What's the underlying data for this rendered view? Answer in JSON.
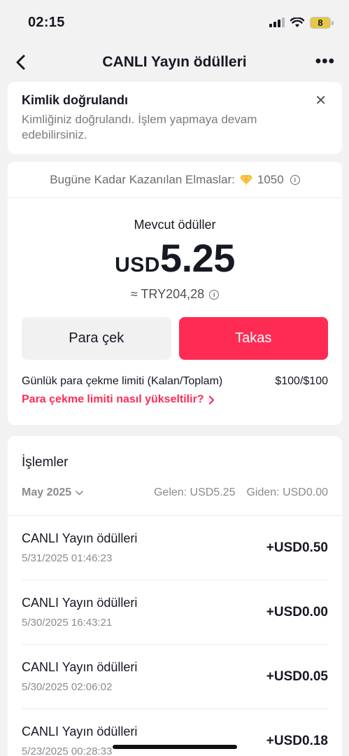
{
  "status": {
    "time": "02:15",
    "battery": "8"
  },
  "nav": {
    "title": "CANLI Yayın ödülleri"
  },
  "verify": {
    "title": "Kimlik doğrulandı",
    "text": "Kimliğiniz doğrulandı. İşlem yapmaya devam edebilirsiniz."
  },
  "balance": {
    "diamonds_label": "Bugüne Kadar Kazanılan Elmaslar:",
    "diamonds_value": "1050",
    "rewards_label": "Mevcut ödüller",
    "currency": "USD",
    "amount": "5.25",
    "try_value": "≈ TRY204,28",
    "withdraw_label": "Para çek",
    "exchange_label": "Takas",
    "limit_label": "Günlük para çekme limiti (Kalan/Toplam)",
    "limit_value": "$100/$100",
    "limit_link": "Para çekme limiti nasıl yükseltilir?"
  },
  "transactions": {
    "title": "İşlemler",
    "month": "May 2025",
    "incoming": "Gelen: USD5.25",
    "outgoing": "Giden: USD0.00",
    "items": [
      {
        "name": "CANLI Yayın ödülleri",
        "date": "5/31/2025 01:46:23",
        "amount": "+USD0.50"
      },
      {
        "name": "CANLI Yayın ödülleri",
        "date": "5/30/2025 16:43:21",
        "amount": "+USD0.00"
      },
      {
        "name": "CANLI Yayın ödülleri",
        "date": "5/30/2025 02:06:02",
        "amount": "+USD0.05"
      },
      {
        "name": "CANLI Yayın ödülleri",
        "date": "5/23/2025 00:28:33",
        "amount": "+USD0.18"
      }
    ]
  },
  "colors": {
    "accent": "#fe2c55",
    "diamond": "#f7b733"
  }
}
